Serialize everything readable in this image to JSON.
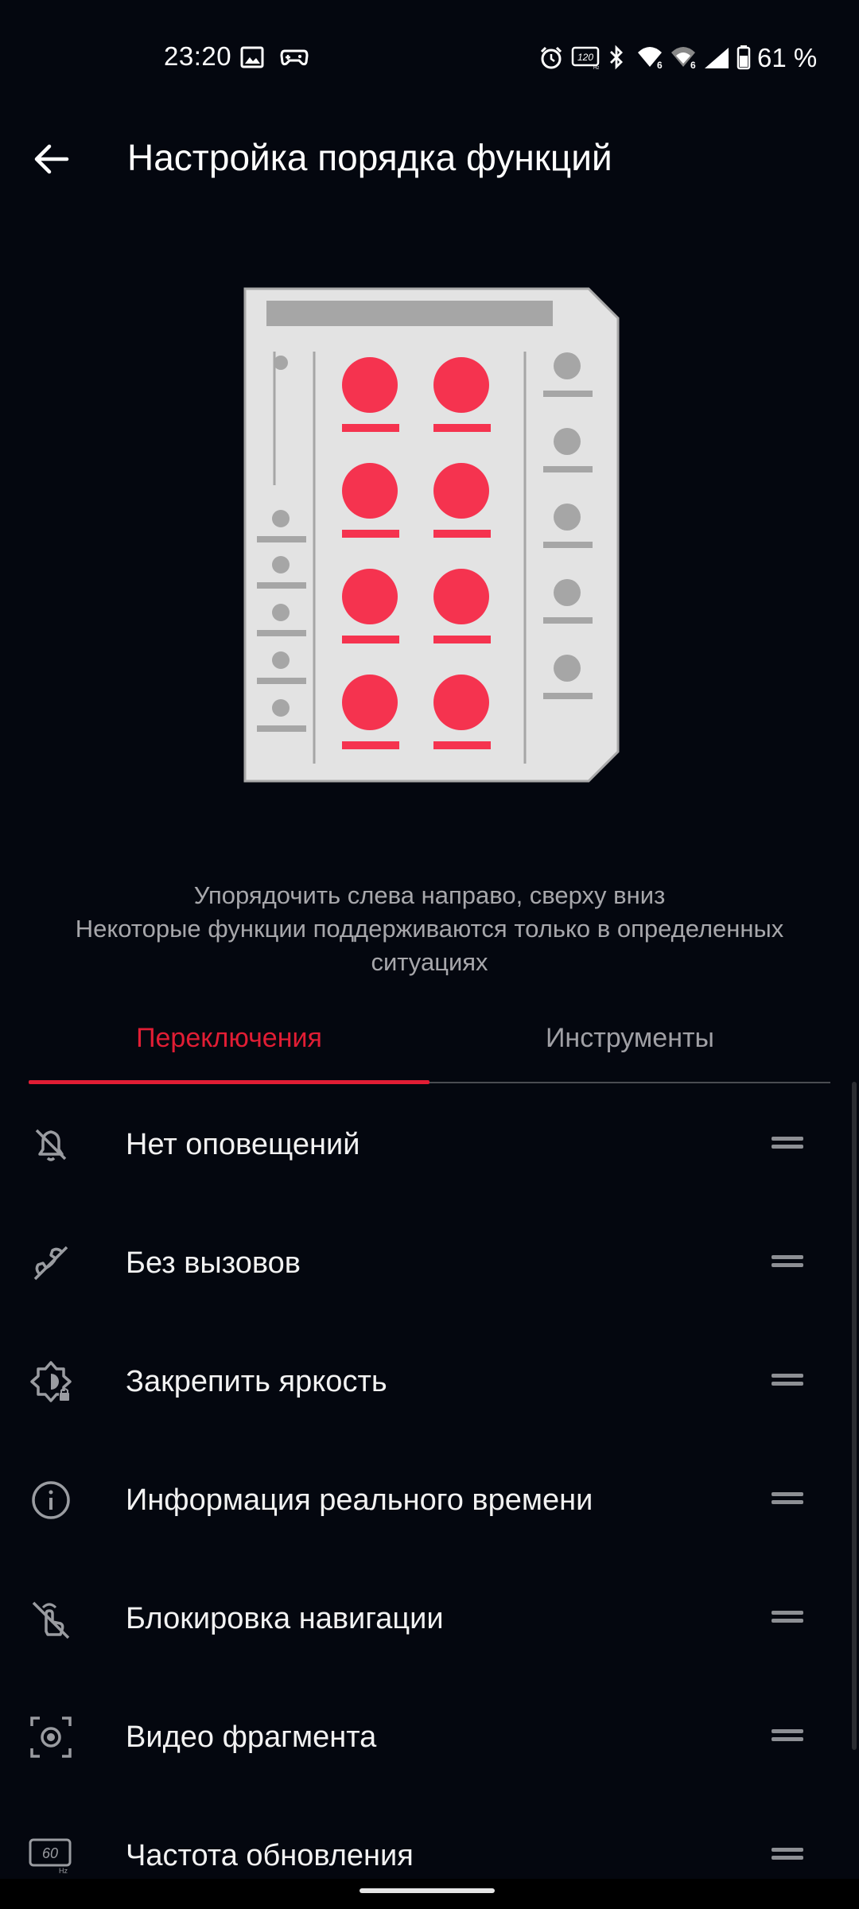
{
  "status_bar": {
    "time": "23:20",
    "battery_percent": "61 %",
    "icons": [
      "image-icon",
      "gamepad-icon",
      "alarm-icon",
      "refresh-120hz-icon",
      "bluetooth-icon",
      "wifi6-icon",
      "wifi6-icon",
      "signal-icon",
      "battery-icon"
    ]
  },
  "app_bar": {
    "title": "Настройка порядка функций"
  },
  "description": {
    "line1": "Упорядочить слева направо, сверху вниз",
    "line2": "Некоторые функции поддерживаются только в определенных",
    "line3": "ситуациях"
  },
  "tabs": [
    {
      "label": "Переключения",
      "selected": true
    },
    {
      "label": "Инструменты",
      "selected": false
    }
  ],
  "list": [
    {
      "label": "Нет оповещений",
      "icon": "bell-off-icon"
    },
    {
      "label": "Без вызовов",
      "icon": "phone-off-icon"
    },
    {
      "label": "Закрепить яркость",
      "icon": "brightness-lock-icon"
    },
    {
      "label": "Информация реального времени",
      "icon": "info-icon"
    },
    {
      "label": "Блокировка навигации",
      "icon": "gesture-off-icon"
    },
    {
      "label": "Видео фрагмента",
      "icon": "video-clip-icon"
    },
    {
      "label": "Частота обновления",
      "icon": "refresh-rate-60hz-icon"
    }
  ],
  "colors": {
    "accent": "#e11d34",
    "background": "#04070f",
    "illustration_card": "#e3e3e3",
    "illustration_dot": "#f5334f"
  }
}
